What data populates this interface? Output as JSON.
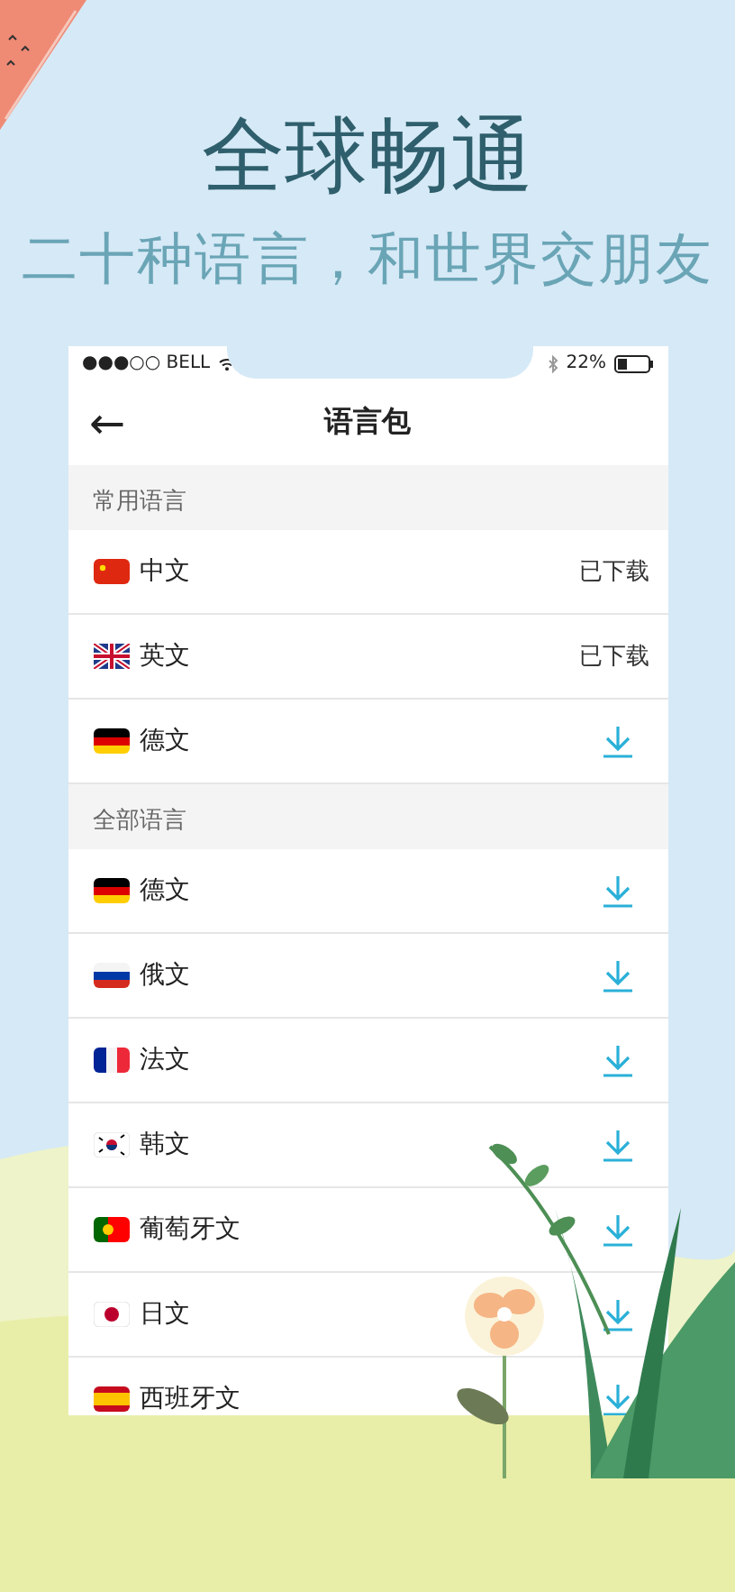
{
  "headline": "全球畅通",
  "subtitle": "二十种语言，和世界交朋友",
  "status_bar": {
    "carrier": "●●●○○ BELL",
    "battery": "22%"
  },
  "nav": {
    "back": "←",
    "title": "语言包"
  },
  "sections": [
    {
      "title": "常用语言",
      "items": [
        {
          "flag": {
            "kind": "cn"
          },
          "name": "中文",
          "kind": "downloaded",
          "status": "已下载"
        },
        {
          "flag": {
            "kind": "gb"
          },
          "name": "英文",
          "kind": "downloaded",
          "status": "已下载"
        },
        {
          "flag": {
            "kind": "de"
          },
          "name": "德文",
          "kind": "download"
        }
      ]
    },
    {
      "title": "全部语言",
      "items": [
        {
          "flag": {
            "kind": "de"
          },
          "name": "德文",
          "kind": "download"
        },
        {
          "flag": {
            "kind": "ru"
          },
          "name": "俄文",
          "kind": "download"
        },
        {
          "flag": {
            "kind": "fr"
          },
          "name": "法文",
          "kind": "download"
        },
        {
          "flag": {
            "kind": "kr"
          },
          "name": "韩文",
          "kind": "download"
        },
        {
          "flag": {
            "kind": "pt"
          },
          "name": "葡萄牙文",
          "kind": "download"
        },
        {
          "flag": {
            "kind": "jp"
          },
          "name": "日文",
          "kind": "download"
        },
        {
          "flag": {
            "kind": "es"
          },
          "name": "西班牙文",
          "kind": "download"
        }
      ]
    }
  ]
}
